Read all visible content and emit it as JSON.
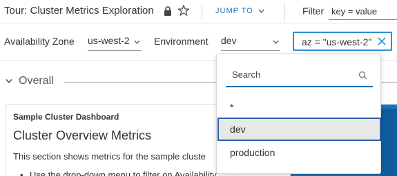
{
  "header": {
    "title": "Tour: Cluster Metrics Exploration",
    "jump_label": "JUMP TO",
    "filter_label": "Filter",
    "filter_placeholder": "key = value"
  },
  "variables": {
    "availability_zone": {
      "label": "Availability Zone",
      "value": "us-west-2"
    },
    "environment": {
      "label": "Environment",
      "value": "dev"
    },
    "active_filter": "az = \"us-west-2\""
  },
  "dropdown": {
    "search_placeholder": "Search",
    "options": [
      "*",
      "dev",
      "production"
    ],
    "selected": "dev"
  },
  "section": {
    "title": "Overall"
  },
  "card": {
    "header": "Sample Cluster Dashboard",
    "title": "Cluster Overview Metrics",
    "description": "This section shows metrics for the sample cluste",
    "bullet_text": "Use the drop-down menu to filter on Availability"
  },
  "colors": {
    "accent": "#1a73b5",
    "focus": "#2a5da8",
    "panel": "#1d72b8"
  },
  "icons": [
    "lock-icon",
    "star-icon",
    "chevron-down-icon",
    "close-icon",
    "search-icon"
  ]
}
